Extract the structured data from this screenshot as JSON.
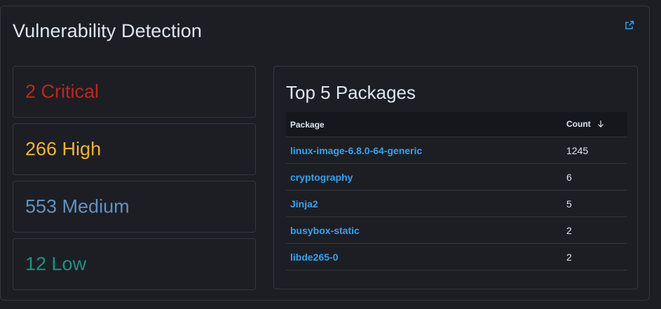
{
  "panel": {
    "title": "Vulnerability Detection"
  },
  "severities": [
    {
      "label": "2 Critical",
      "color": "#bd271e"
    },
    {
      "label": "266 High",
      "color": "#f2b33a"
    },
    {
      "label": "553 Medium",
      "color": "#6092c0"
    },
    {
      "label": "12 Low",
      "color": "#209280"
    }
  ],
  "top_packages": {
    "title": "Top 5 Packages",
    "columns": {
      "package": "Package",
      "count": "Count"
    },
    "rows": [
      {
        "package": "linux-image-6.8.0-64-generic",
        "count": "1245"
      },
      {
        "package": "cryptography",
        "count": "6"
      },
      {
        "package": "Jinja2",
        "count": "5"
      },
      {
        "package": "busybox-static",
        "count": "2"
      },
      {
        "package": "libde265-0",
        "count": "2"
      }
    ]
  },
  "colors": {
    "link": "#36a2ef",
    "text": "#dfe5ef",
    "border": "#343741",
    "background": "#1d1e24"
  },
  "icons": {
    "external_link": "external-link-icon",
    "sort": "arrow-down-icon"
  }
}
